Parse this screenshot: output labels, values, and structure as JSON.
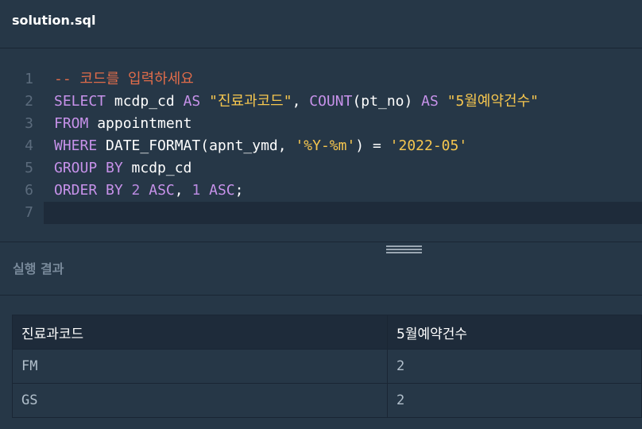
{
  "tab": {
    "title": "solution.sql"
  },
  "editor": {
    "lines": [
      {
        "n": "1",
        "tokens": [
          {
            "t": "-- 코드를 입력하세요",
            "c": "cmt"
          }
        ]
      },
      {
        "n": "2",
        "tokens": [
          {
            "t": "SELECT",
            "c": "kw"
          },
          {
            "t": " mcdp_cd ",
            "c": "plain"
          },
          {
            "t": "AS",
            "c": "kw"
          },
          {
            "t": " ",
            "c": "plain"
          },
          {
            "t": "\"진료과코드\"",
            "c": "str"
          },
          {
            "t": ", ",
            "c": "plain"
          },
          {
            "t": "COUNT",
            "c": "kw"
          },
          {
            "t": "(pt_no) ",
            "c": "plain"
          },
          {
            "t": "AS",
            "c": "kw"
          },
          {
            "t": " ",
            "c": "plain"
          },
          {
            "t": "\"5월예약건수\"",
            "c": "str"
          }
        ]
      },
      {
        "n": "3",
        "tokens": [
          {
            "t": "FROM",
            "c": "kw"
          },
          {
            "t": " appointment",
            "c": "plain"
          }
        ]
      },
      {
        "n": "4",
        "tokens": [
          {
            "t": "WHERE",
            "c": "kw"
          },
          {
            "t": " DATE_FORMAT(apnt_ymd, ",
            "c": "plain"
          },
          {
            "t": "'%Y-%m'",
            "c": "str"
          },
          {
            "t": ") = ",
            "c": "plain"
          },
          {
            "t": "'2022-05'",
            "c": "str"
          }
        ]
      },
      {
        "n": "5",
        "tokens": [
          {
            "t": "GROUP BY",
            "c": "kw"
          },
          {
            "t": " mcdp_cd",
            "c": "plain"
          }
        ]
      },
      {
        "n": "6",
        "tokens": [
          {
            "t": "ORDER BY",
            "c": "kw"
          },
          {
            "t": " ",
            "c": "plain"
          },
          {
            "t": "2",
            "c": "num"
          },
          {
            "t": " ",
            "c": "plain"
          },
          {
            "t": "ASC",
            "c": "kw"
          },
          {
            "t": ", ",
            "c": "plain"
          },
          {
            "t": "1",
            "c": "num"
          },
          {
            "t": " ",
            "c": "plain"
          },
          {
            "t": "ASC",
            "c": "kw"
          },
          {
            "t": ";",
            "c": "plain"
          }
        ]
      },
      {
        "n": "7",
        "tokens": []
      }
    ],
    "active_line": "7"
  },
  "result": {
    "header": "실행 결과",
    "columns": [
      "진료과코드",
      "5월예약건수"
    ],
    "rows": [
      [
        "FM",
        "2"
      ],
      [
        "GS",
        "2"
      ]
    ]
  }
}
